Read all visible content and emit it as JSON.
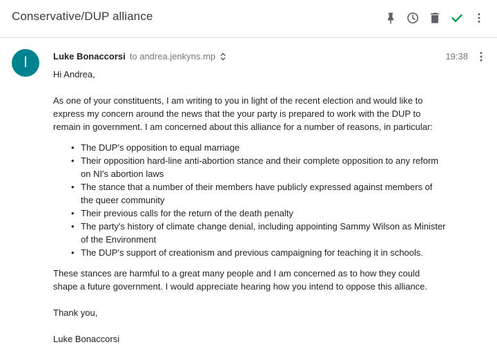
{
  "thread": {
    "subject": "Conservative/DUP alliance"
  },
  "toolbar": {
    "icons": [
      "pin-icon",
      "snooze-icon",
      "trash-icon",
      "done-icon",
      "more-icon"
    ],
    "done_color": "#0f9d58"
  },
  "message": {
    "avatar_letter": "l",
    "avatar_color": "#00838f",
    "sender": "Luke Bonaccorsi",
    "recipient": "to andrea.jenkyns.mp",
    "time": "19:38",
    "greeting": "Hi Andrea,",
    "paragraph1": "As one of your constituents, I am writing to you in light of the recent election and would like to express my concern around the news that the your party is prepared to work with the DUP to remain in government. I am concerned about this alliance for a number of reasons, in particular:",
    "bullets": [
      "The DUP's opposition to equal marriage",
      "Their opposition hard-line anti-abortion stance and their complete opposition to any reform on NI's abortion laws",
      "The stance that a number of their members have publicly expressed against members of the queer community",
      "Their previous calls for the return of the death penalty",
      "The party's history of climate change denial, including appointing Sammy Wilson as Minister of the Environment",
      "The DUP's support of creationism and previous campaigning for teaching it in schools."
    ],
    "paragraph2": "These stances are harmful to a great many people and I am concerned as to how they could shape a future government. I would appreciate hearing how you intend to oppose this alliance.",
    "closing": "Thank you,",
    "signature": "Luke Bonaccorsi"
  }
}
